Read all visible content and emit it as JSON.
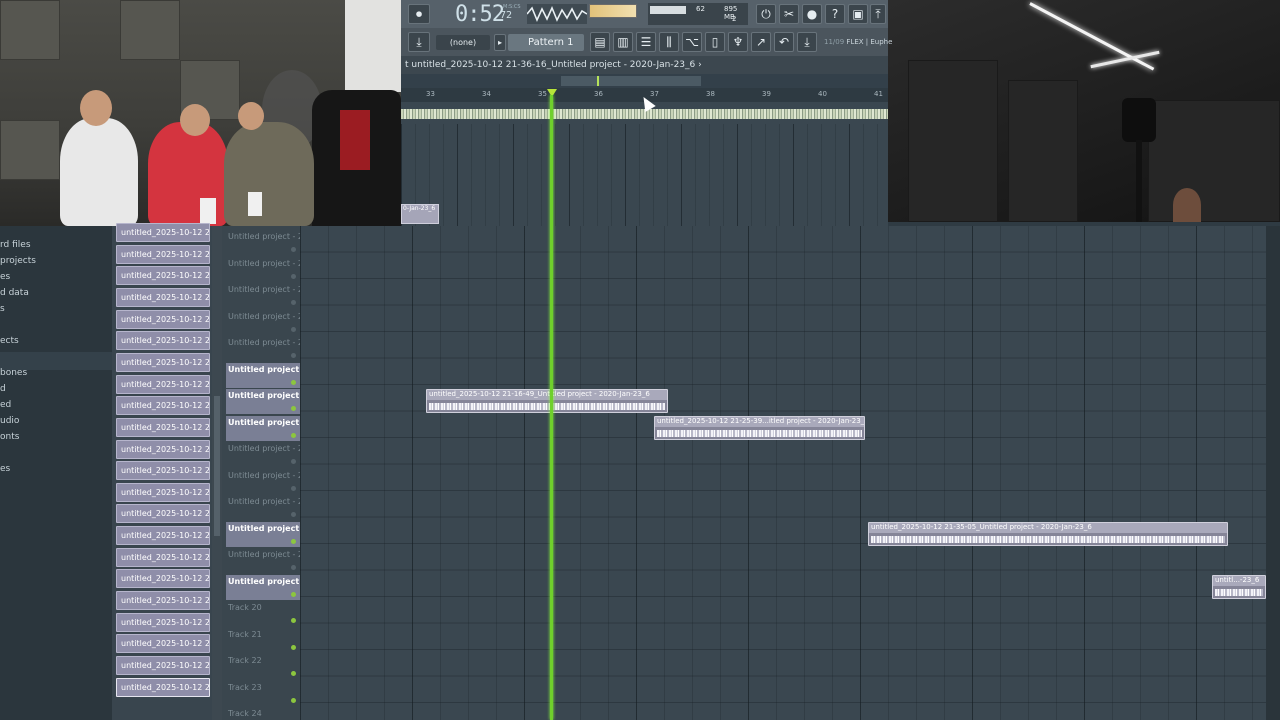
{
  "window_title_prefix": "t",
  "playlist_title": "untitled_2025-10-12 21-36-16_Untitled project - 2020-Jan-23_6",
  "toolbar": {
    "time_main": "0:52",
    "time_small": "72",
    "time_unit": "M:S:CS",
    "cpu": "62",
    "memory": "895 MB",
    "polyphony": "2",
    "pattern_none": "(none)",
    "pattern_name": "Pattern 1",
    "flex_label": "11/09",
    "flex_plugin": "FLEX | Euphe"
  },
  "sidebar": {
    "items": [
      "rd files",
      "projects",
      "es",
      "d data",
      "s",
      "ects",
      "bones",
      "d",
      "ed",
      "udio",
      "onts",
      "es"
    ]
  },
  "clip_browser": {
    "items": [
      "untitled_2025-10-12 21-...",
      "untitled_2025-10-12 21-...",
      "untitled_2025-10-12 21-...",
      "untitled_2025-10-12 21-...",
      "untitled_2025-10-12 21-...",
      "untitled_2025-10-12 21-...",
      "untitled_2025-10-12 21-...",
      "untitled_2025-10-12 21-...",
      "untitled_2025-10-12 21-...",
      "untitled_2025-10-12 21-...",
      "untitled_2025-10-12 21-...",
      "untitled_2025-10-12 21-...",
      "untitled_2025-10-12 21-...",
      "untitled_2025-10-12 21-...",
      "untitled_2025-10-12 21-...",
      "untitled_2025-10-12 21-...",
      "untitled_2025-10-12 21-...",
      "untitled_2025-10-12 21-...",
      "untitled_2025-10-12 21-...",
      "untitled_2025-10-12 21-...",
      "untitled_2025-10-12 21-...",
      "untitled_2025-10-12 21-..."
    ]
  },
  "tracks": [
    {
      "label": "Untitled project - 2...",
      "active": false
    },
    {
      "label": "Untitled project - 2...",
      "active": false
    },
    {
      "label": "Untitled project - 2...",
      "active": false
    },
    {
      "label": "Untitled project - 2...",
      "active": false
    },
    {
      "label": "Untitled project - 2...",
      "active": false
    },
    {
      "label": "Untitled project - 2...",
      "active": true
    },
    {
      "label": "Untitled project - 2...",
      "active": true
    },
    {
      "label": "Untitled project - 2...",
      "active": true
    },
    {
      "label": "Untitled project - 2...",
      "active": false
    },
    {
      "label": "Untitled project - 2...",
      "active": false
    },
    {
      "label": "Untitled project - 2...",
      "active": false
    },
    {
      "label": "Untitled project - 2...",
      "active": true
    },
    {
      "label": "Untitled project - 2...",
      "active": false
    },
    {
      "label": "Untitled project - 2...",
      "active": true
    },
    {
      "label": "Track 20",
      "active": false
    },
    {
      "label": "Track 21",
      "active": false
    },
    {
      "label": "Track 22",
      "active": false
    },
    {
      "label": "Track 23",
      "active": false
    },
    {
      "label": "Track 24",
      "active": false
    }
  ],
  "ruler_ticks": [
    "33",
    "34",
    "35",
    "36",
    "37",
    "38",
    "39",
    "40",
    "41"
  ],
  "playlist_clips": [
    {
      "label": "untitled_2025-10-12 21-16-49_Untitled project - 2020-Jan-23_6"
    },
    {
      "label": "untitled_2025-10-12 21-25-39...itled project - 2020-Jan-23_6"
    },
    {
      "label": "untitled_2025-10-12 21-35-05_Untitled project - 2020-Jan-23_6"
    },
    {
      "label": "untitl...-23_6"
    }
  ],
  "small_clip_label": "0-Jan-23_6",
  "colors": {
    "playhead": "#6fd02c",
    "clip": "#a9a9bb",
    "track_active": "#7a7f95",
    "grid": "#3a4750"
  }
}
